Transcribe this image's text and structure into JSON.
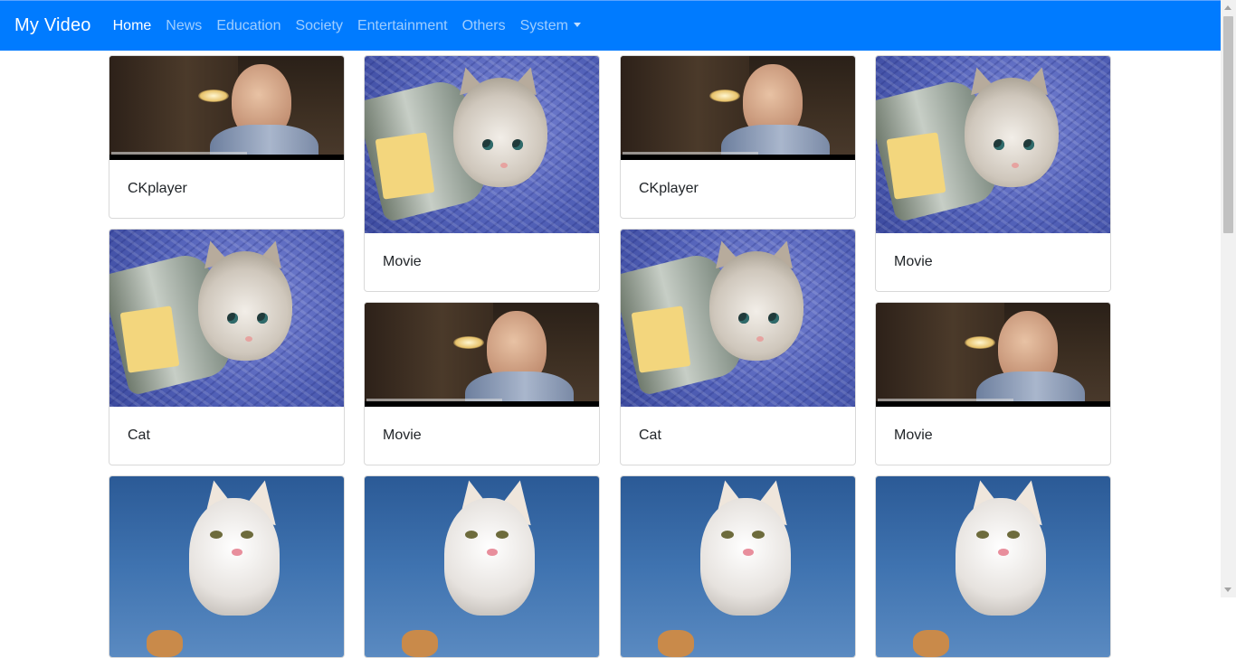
{
  "navbar": {
    "brand": "My Video",
    "links": [
      {
        "label": "Home",
        "active": true
      },
      {
        "label": "News"
      },
      {
        "label": "Education"
      },
      {
        "label": "Society"
      },
      {
        "label": "Entertainment"
      },
      {
        "label": "Others"
      },
      {
        "label": "System",
        "dropdown": true
      }
    ]
  },
  "cards": [
    {
      "title": "CKplayer",
      "thumbnail": "man-scene"
    },
    {
      "title": "Movie",
      "thumbnail": "kitten-in-bucket"
    },
    {
      "title": "CKplayer",
      "thumbnail": "man-scene"
    },
    {
      "title": "Movie",
      "thumbnail": "kitten-in-bucket"
    },
    {
      "title": "Cat",
      "thumbnail": "kitten-in-bucket"
    },
    {
      "title": "Movie",
      "thumbnail": "man-scene"
    },
    {
      "title": "Cat",
      "thumbnail": "kitten-in-bucket"
    },
    {
      "title": "Movie",
      "thumbnail": "man-scene"
    },
    {
      "title": "",
      "thumbnail": "white-cat-sky"
    },
    {
      "title": "",
      "thumbnail": "white-cat-sky"
    },
    {
      "title": "",
      "thumbnail": "white-cat-sky"
    },
    {
      "title": "",
      "thumbnail": "white-cat-sky"
    }
  ],
  "colors": {
    "navbar": "#007bff",
    "border": "#d9d9d9",
    "text": "#212529"
  }
}
